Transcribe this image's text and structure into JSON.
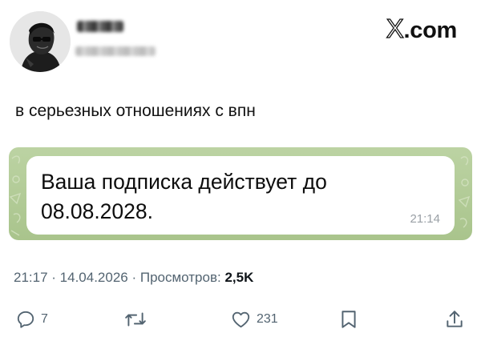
{
  "header": {
    "site": {
      "x_letter": "X",
      "domain_rest": ".com"
    }
  },
  "tweet": {
    "text": "в серьезных отношениях с впн",
    "message": {
      "text": "Ваша подписка действует до 08.08.2028.",
      "time": "21:14"
    },
    "meta": {
      "time": "21:17",
      "sep1": " · ",
      "date": "14.04.2026",
      "sep2": " · ",
      "views_label": "Просмотров: ",
      "views_count": "2,5K"
    }
  },
  "actions": {
    "reply_icon": "reply-icon",
    "replies": "7",
    "retweet_icon": "retweet-icon",
    "like_icon": "heart-icon",
    "likes": "231",
    "bookmark_icon": "bookmark-icon",
    "share_icon": "share-icon"
  },
  "colors": {
    "text": "#0f1419",
    "secondary": "#536471",
    "chat_background": "#b1ca95",
    "bubble": "#ffffff",
    "bubble_time": "#9aa0a6"
  }
}
